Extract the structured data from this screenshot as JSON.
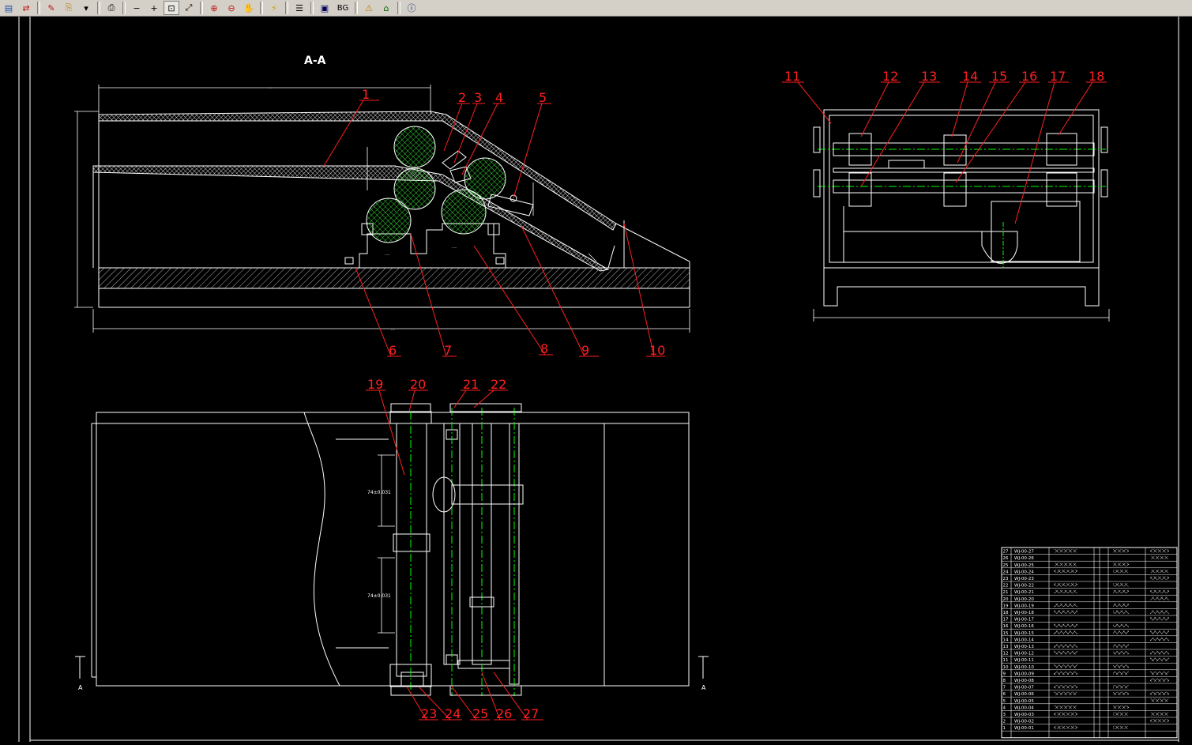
{
  "toolbar": {
    "buttons": [
      {
        "name": "open-icon",
        "glyph": "▤",
        "color": "#1a4fb0"
      },
      {
        "name": "convert-icon",
        "glyph": "⇄",
        "color": "#c01010"
      },
      {
        "name": "markup-icon",
        "glyph": "✎",
        "color": "#c01010"
      },
      {
        "name": "copy-icon",
        "glyph": "⎘",
        "color": "#c08000"
      },
      {
        "name": "dropdown-arrow-icon",
        "glyph": "▾",
        "color": "#000000"
      },
      {
        "name": "print-icon",
        "glyph": "⎙",
        "color": "#000000"
      },
      {
        "name": "zoom-out-icon",
        "glyph": "−",
        "color": "#000000"
      },
      {
        "name": "zoom-in-icon",
        "glyph": "+",
        "color": "#000000"
      },
      {
        "name": "zoom-window-icon",
        "glyph": "⊡",
        "color": "#000000"
      },
      {
        "name": "zoom-realtime-icon",
        "glyph": "⤢",
        "color": "#000000"
      },
      {
        "name": "zoom-extents-icon",
        "glyph": "⊕",
        "color": "#c01010"
      },
      {
        "name": "zoom-previous-icon",
        "glyph": "⊖",
        "color": "#c01010"
      },
      {
        "name": "pan-icon",
        "glyph": "✋",
        "color": "#006000"
      },
      {
        "name": "regen-icon",
        "glyph": "⚡",
        "color": "#d0a000"
      },
      {
        "name": "layers-icon",
        "glyph": "☰",
        "color": "#000000"
      },
      {
        "name": "frame-icon",
        "glyph": "▣",
        "color": "#000060"
      },
      {
        "name": "background-toggle",
        "glyph": "BG",
        "color": "#000000"
      },
      {
        "name": "warning-icon",
        "glyph": "⚠",
        "color": "#c08000"
      },
      {
        "name": "home-icon",
        "glyph": "⌂",
        "color": "#006000"
      },
      {
        "name": "info-icon",
        "glyph": "ⓘ",
        "color": "#102080"
      }
    ]
  },
  "drawing": {
    "section_title": "A-A",
    "balloons_section": [
      "1",
      "2",
      "3",
      "4",
      "5",
      "6",
      "7",
      "8",
      "9",
      "10"
    ],
    "balloons_side": [
      "11",
      "12",
      "13",
      "14",
      "15",
      "16",
      "17",
      "18"
    ],
    "balloons_plan": [
      "19",
      "20",
      "21",
      "22",
      "23",
      "24",
      "25",
      "26",
      "27"
    ],
    "dim_plan_1": "74±0.031",
    "dim_plan_2": "74±0.031",
    "section_mark": "A",
    "colors": {
      "line": "#ffffff",
      "balloon": "#ff2020",
      "center": "#00ff00",
      "hatch": "#c0c0c0"
    }
  },
  "bom": {
    "rows": [
      {
        "no": "27",
        "code": "WJ-00-27"
      },
      {
        "no": "26",
        "code": "WJ-00-26"
      },
      {
        "no": "25",
        "code": "WJ-00-25"
      },
      {
        "no": "24",
        "code": "WJ-00-24"
      },
      {
        "no": "23",
        "code": "WJ-00-23"
      },
      {
        "no": "22",
        "code": "WJ-00-22"
      },
      {
        "no": "21",
        "code": "WJ-00-21"
      },
      {
        "no": "20",
        "code": "WJ-00-20"
      },
      {
        "no": "19",
        "code": "WJ-00-19"
      },
      {
        "no": "18",
        "code": "WJ-00-18"
      },
      {
        "no": "17",
        "code": "WJ-00-17"
      },
      {
        "no": "16",
        "code": "WJ-00-16"
      },
      {
        "no": "15",
        "code": "WJ-00-15"
      },
      {
        "no": "14",
        "code": "WJ-00-14"
      },
      {
        "no": "13",
        "code": "WJ-00-13"
      },
      {
        "no": "12",
        "code": "WJ-00-12"
      },
      {
        "no": "11",
        "code": "WJ-00-11"
      },
      {
        "no": "10",
        "code": "WJ-00-10"
      },
      {
        "no": "9",
        "code": "WJ-00-09"
      },
      {
        "no": "8",
        "code": "WJ-00-08"
      },
      {
        "no": "7",
        "code": "WJ-00-07"
      },
      {
        "no": "6",
        "code": "WJ-00-06"
      },
      {
        "no": "5",
        "code": "WJ-00-05"
      },
      {
        "no": "4",
        "code": "WJ-00-04"
      },
      {
        "no": "3",
        "code": "WJ-00-03"
      },
      {
        "no": "2",
        "code": "WJ-00-02"
      },
      {
        "no": "1",
        "code": "WJ-00-01"
      }
    ]
  }
}
